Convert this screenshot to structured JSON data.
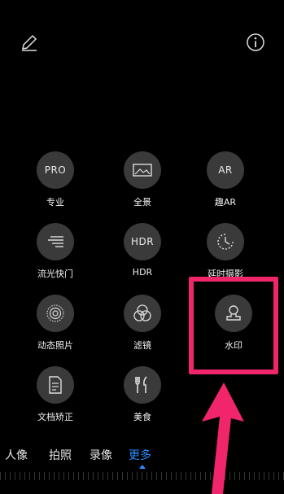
{
  "modes": [
    {
      "id": "pro",
      "label": "专业",
      "glyph": "PRO"
    },
    {
      "id": "panorama",
      "label": "全景",
      "glyph": ""
    },
    {
      "id": "ar",
      "label": "趣AR",
      "glyph": "AR"
    },
    {
      "id": "light-painting",
      "label": "流光快门",
      "glyph": ""
    },
    {
      "id": "hdr",
      "label": "HDR",
      "glyph": "HDR"
    },
    {
      "id": "timelapse",
      "label": "延时摄影",
      "glyph": ""
    },
    {
      "id": "moving-picture",
      "label": "动态照片",
      "glyph": ""
    },
    {
      "id": "filter",
      "label": "滤镜",
      "glyph": ""
    },
    {
      "id": "watermark",
      "label": "水印",
      "glyph": ""
    },
    {
      "id": "document",
      "label": "文档矫正",
      "glyph": ""
    },
    {
      "id": "food",
      "label": "美食",
      "glyph": ""
    }
  ],
  "tabs": [
    {
      "label": "人像"
    },
    {
      "label": "拍照"
    },
    {
      "label": "录像"
    },
    {
      "label": "更多"
    }
  ],
  "colors": {
    "accent": "#2a8cff",
    "highlight": "#f0256b",
    "circle": "#3a3a3a"
  }
}
